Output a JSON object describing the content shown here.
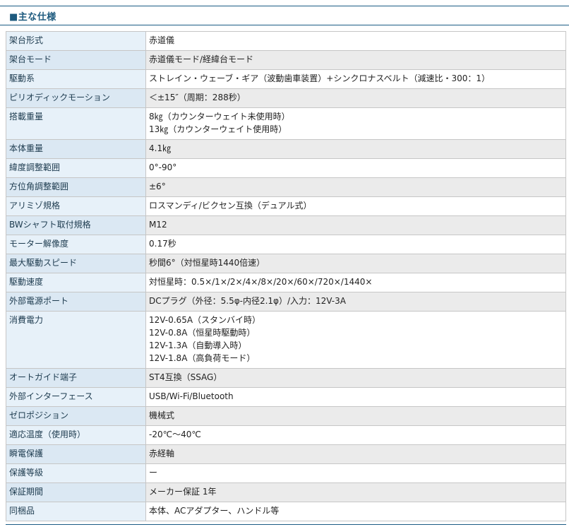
{
  "section": {
    "title": "■主な仕様"
  },
  "specs": [
    {
      "label": "架台形式",
      "lines": [
        "赤道儀"
      ]
    },
    {
      "label": "架台モード",
      "lines": [
        "赤道儀モード/経緯台モード"
      ]
    },
    {
      "label": "駆動系",
      "lines": [
        "ストレイン・ウェーブ・ギア（波動歯車装置）+シンクロナスベルト（減速比・300：1）"
      ]
    },
    {
      "label": "ピリオディックモーション",
      "lines": [
        "＜±15″（周期：288秒）"
      ]
    },
    {
      "label": "搭載重量",
      "lines": [
        "8㎏（カウンターウェイト未使用時）",
        "13㎏（カウンターウェイト使用時）"
      ]
    },
    {
      "label": "本体重量",
      "lines": [
        "4.1㎏"
      ]
    },
    {
      "label": "緯度調整範囲",
      "lines": [
        "0°-90°"
      ]
    },
    {
      "label": "方位角調整範囲",
      "lines": [
        "±6°"
      ]
    },
    {
      "label": "アリミゾ規格",
      "lines": [
        "ロスマンディ/ビクセン互換（デュアル式）"
      ]
    },
    {
      "label": "BWシャフト取付規格",
      "lines": [
        "M12"
      ]
    },
    {
      "label": "モーター解像度",
      "lines": [
        "0.17秒"
      ]
    },
    {
      "label": "最大駆動スピード",
      "lines": [
        "秒間6°（対恒星時1440倍速）"
      ]
    },
    {
      "label": "駆動速度",
      "lines": [
        "対恒星時：0.5×/1×/2×/4×/8×/20×/60×/720×/1440×"
      ]
    },
    {
      "label": "外部電源ポート",
      "lines": [
        "DCプラグ（外径：5.5φ-内径2.1φ）/入力：12V-3A"
      ]
    },
    {
      "label": "消費電力",
      "lines": [
        "12V-0.65A（スタンバイ時）",
        "12V-0.8A（恒星時駆動時）",
        "12V-1.3A（自動導入時）",
        "12V-1.8A（高負荷モード）"
      ]
    },
    {
      "label": "オートガイド端子",
      "lines": [
        "ST4互換（SSAG）"
      ]
    },
    {
      "label": "外部インターフェース",
      "lines": [
        "USB/Wi-Fi/Bluetooth"
      ]
    },
    {
      "label": "ゼロポジション",
      "lines": [
        "機械式"
      ]
    },
    {
      "label": "適応温度（使用時）",
      "lines": [
        "-20℃〜40℃"
      ]
    },
    {
      "label": "瞬電保護",
      "lines": [
        "赤経軸"
      ]
    },
    {
      "label": "保護等級",
      "lines": [
        "ー"
      ]
    },
    {
      "label": "保証期間",
      "lines": [
        "メーカー保証 1年"
      ]
    },
    {
      "label": "同梱品",
      "lines": [
        "本体、ACアダプター、ハンドル等"
      ]
    }
  ]
}
